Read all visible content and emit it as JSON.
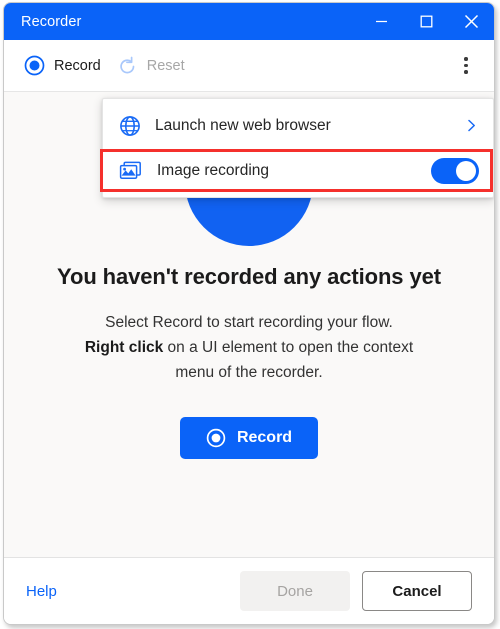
{
  "window": {
    "title": "Recorder",
    "caption_buttons": [
      {
        "name": "minimize",
        "label": "Minimize"
      },
      {
        "name": "maximize",
        "label": "Maximize"
      },
      {
        "name": "close",
        "label": "Close"
      }
    ]
  },
  "toolbar": {
    "record_label": "Record",
    "reset_label": "Reset",
    "reset_disabled": true,
    "overflow_label": "More options"
  },
  "flyout": {
    "items": [
      {
        "icon": "globe-icon",
        "label": "Launch new web browser",
        "trailing": "chevron-right-icon"
      },
      {
        "icon": "image-stack-icon",
        "label": "Image recording",
        "trailing": "toggle-switch",
        "toggle_on": true
      }
    ]
  },
  "main": {
    "illustration_name": "record-camera-illustration",
    "headline": "You haven't recorded any actions yet",
    "subtext_line1": "Select Record to start recording your flow.",
    "subtext_bold": "Right click",
    "subtext_line2_rest": " on a UI element to open the context",
    "subtext_line3": "menu of the recorder.",
    "record_button_label": "Record"
  },
  "footer": {
    "help_label": "Help",
    "done_label": "Done",
    "done_disabled": true,
    "cancel_label": "Cancel"
  },
  "colors": {
    "accent": "#0a63f8",
    "titlebar": "#0a63f8",
    "content_bg": "#faf9f8",
    "annotation": "#f5302c",
    "disabled_text": "#a7a7a7"
  }
}
